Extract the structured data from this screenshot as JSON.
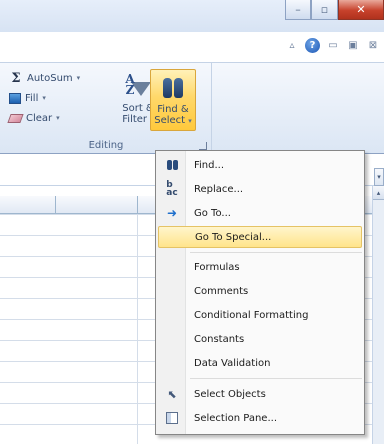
{
  "window": {
    "minimize_glyph": "–",
    "maximize_glyph": "▫",
    "close_glyph": "✕"
  },
  "ribbon": {
    "autosum_label": "AutoSum",
    "fill_label": "Fill",
    "clear_label": "Clear",
    "sort_filter_label_line1": "Sort &",
    "sort_filter_label_line2": "Filter",
    "find_select_label_line1": "Find &",
    "find_select_label_line2": "Select",
    "caret": "▾",
    "group_label": "Editing"
  },
  "menu": {
    "items": [
      {
        "label": "Find...",
        "icon": "binoculars-icon"
      },
      {
        "label": "Replace...",
        "icon": "replace-icon"
      },
      {
        "label": "Go To...",
        "icon": "arrow-right-icon"
      },
      {
        "label": "Go To Special...",
        "icon": "",
        "highlighted": true
      },
      {
        "label": "Formulas",
        "icon": ""
      },
      {
        "label": "Comments",
        "icon": ""
      },
      {
        "label": "Conditional Formatting",
        "icon": ""
      },
      {
        "label": "Constants",
        "icon": ""
      },
      {
        "label": "Data Validation",
        "icon": ""
      },
      {
        "label": "Select Objects",
        "icon": "select-pointer-icon"
      },
      {
        "label": "Selection Pane...",
        "icon": "selection-pane-icon"
      }
    ]
  },
  "colors": {
    "highlight": "#ffe48b",
    "ribbon_bg": "#dbe6f4",
    "close_red": "#c7422c"
  }
}
